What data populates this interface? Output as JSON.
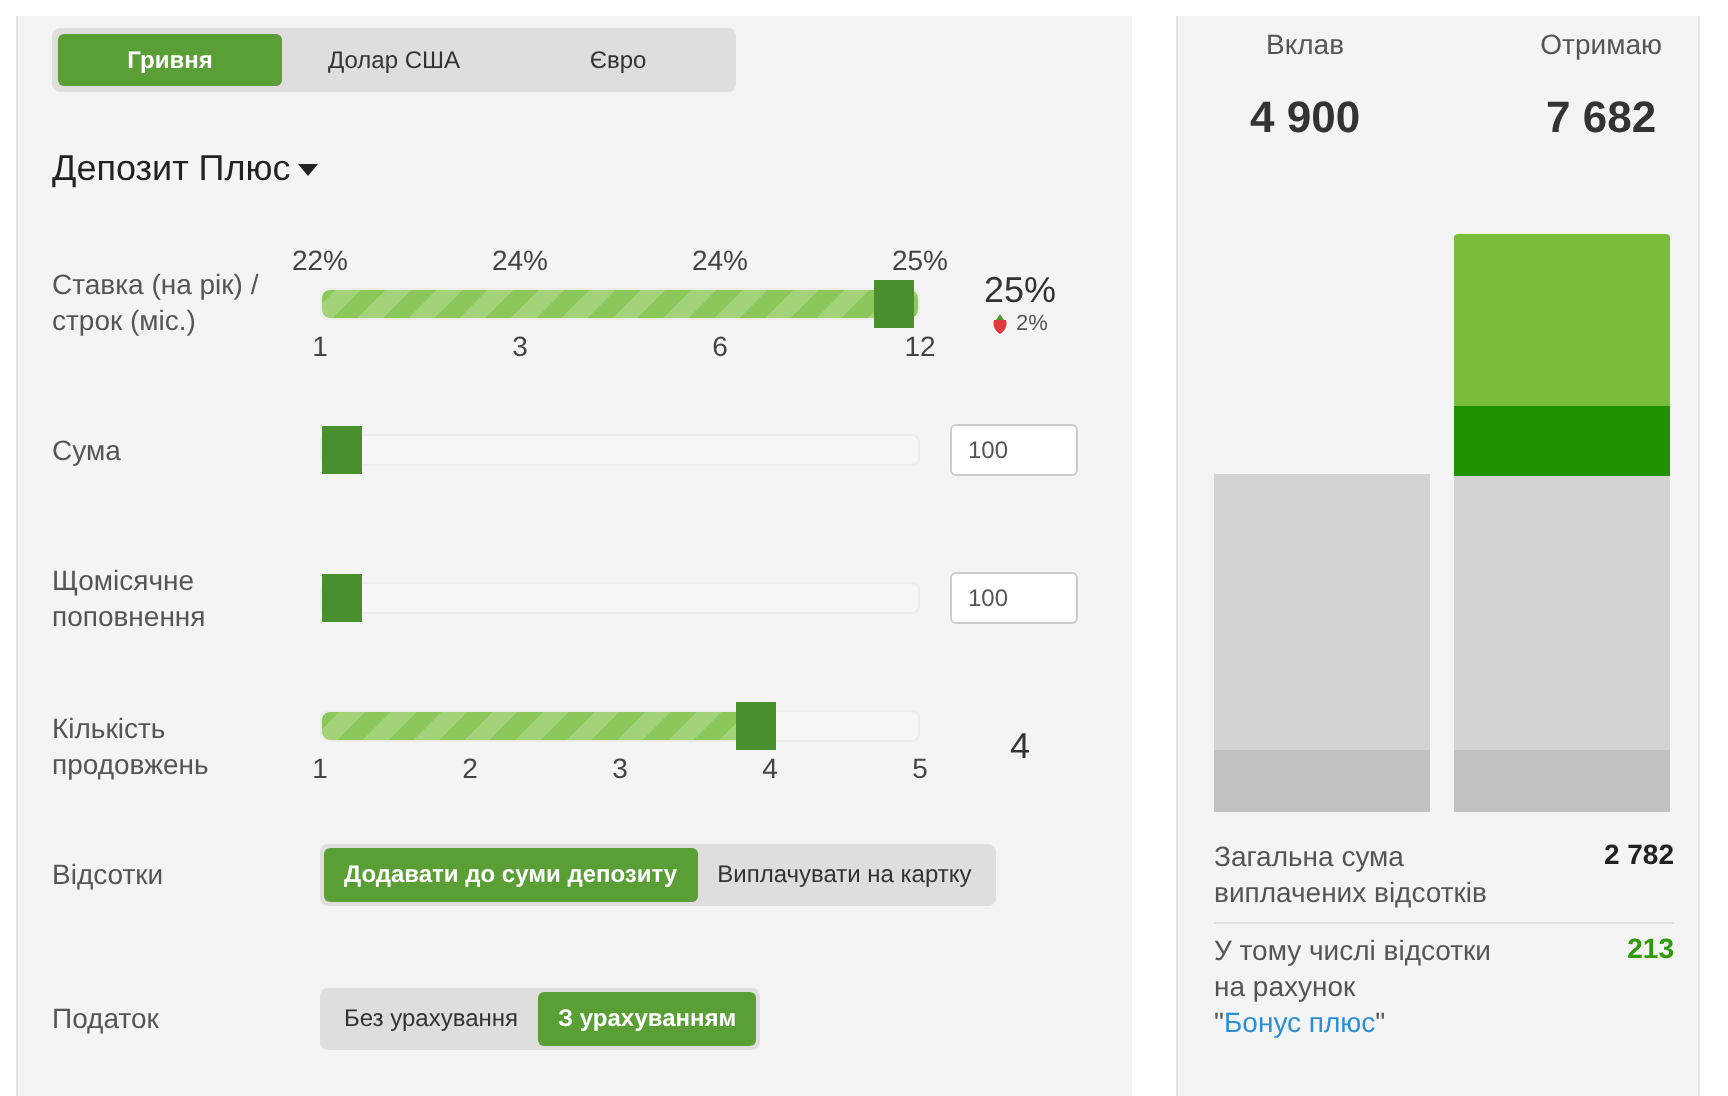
{
  "currency_tabs": [
    {
      "label": "Гривня",
      "selected": true
    },
    {
      "label": "Долар США",
      "selected": false
    },
    {
      "label": "Євро",
      "selected": false
    }
  ],
  "product": {
    "title": "Депозит Плюс"
  },
  "rows": [
    {
      "kind": "slider",
      "label": "Ставка (на рік) / строк (міс.)",
      "level": 1,
      "top_ticks": [
        "22%",
        "24%",
        "24%",
        "25%"
      ],
      "bottom_ticks": [
        "1",
        "3",
        "6",
        "12"
      ],
      "reading": "25%",
      "bonus": "2%"
    },
    {
      "kind": "slider",
      "label": "Сума",
      "level": 0,
      "input": "100"
    },
    {
      "kind": "slider",
      "label": "Щомісячне поповнення",
      "level": 0,
      "input": "100"
    },
    {
      "kind": "slider",
      "label": "Кількість продовжень",
      "level": 0.75,
      "bottom_ticks": [
        "1",
        "2",
        "3",
        "4",
        "5"
      ],
      "reading": "4"
    },
    {
      "kind": "toggle",
      "label": "Відсотки",
      "options": [
        {
          "label": "Додавати до суми депозиту",
          "selected": true
        },
        {
          "label": "Виплачувати на картку",
          "selected": false
        }
      ]
    },
    {
      "kind": "toggle",
      "label": "Податок",
      "options": [
        {
          "label": "Без урахування",
          "selected": false
        },
        {
          "label": "З урахуванням",
          "selected": true
        }
      ]
    }
  ],
  "summary": {
    "columns": [
      {
        "label": "Вклав",
        "value": "4 900"
      },
      {
        "label": "Отримаю",
        "value": "7 682"
      }
    ],
    "totals": [
      {
        "label": "Загальна сума виплачених відсотків",
        "value": "2 782",
        "color": "#222222"
      },
      {
        "label": "У тому числі відсотки на рахунок \"",
        "link": "Бонус плюс",
        "label_after": "\"",
        "value": "213",
        "color": "#2e9a0c"
      }
    ]
  }
}
